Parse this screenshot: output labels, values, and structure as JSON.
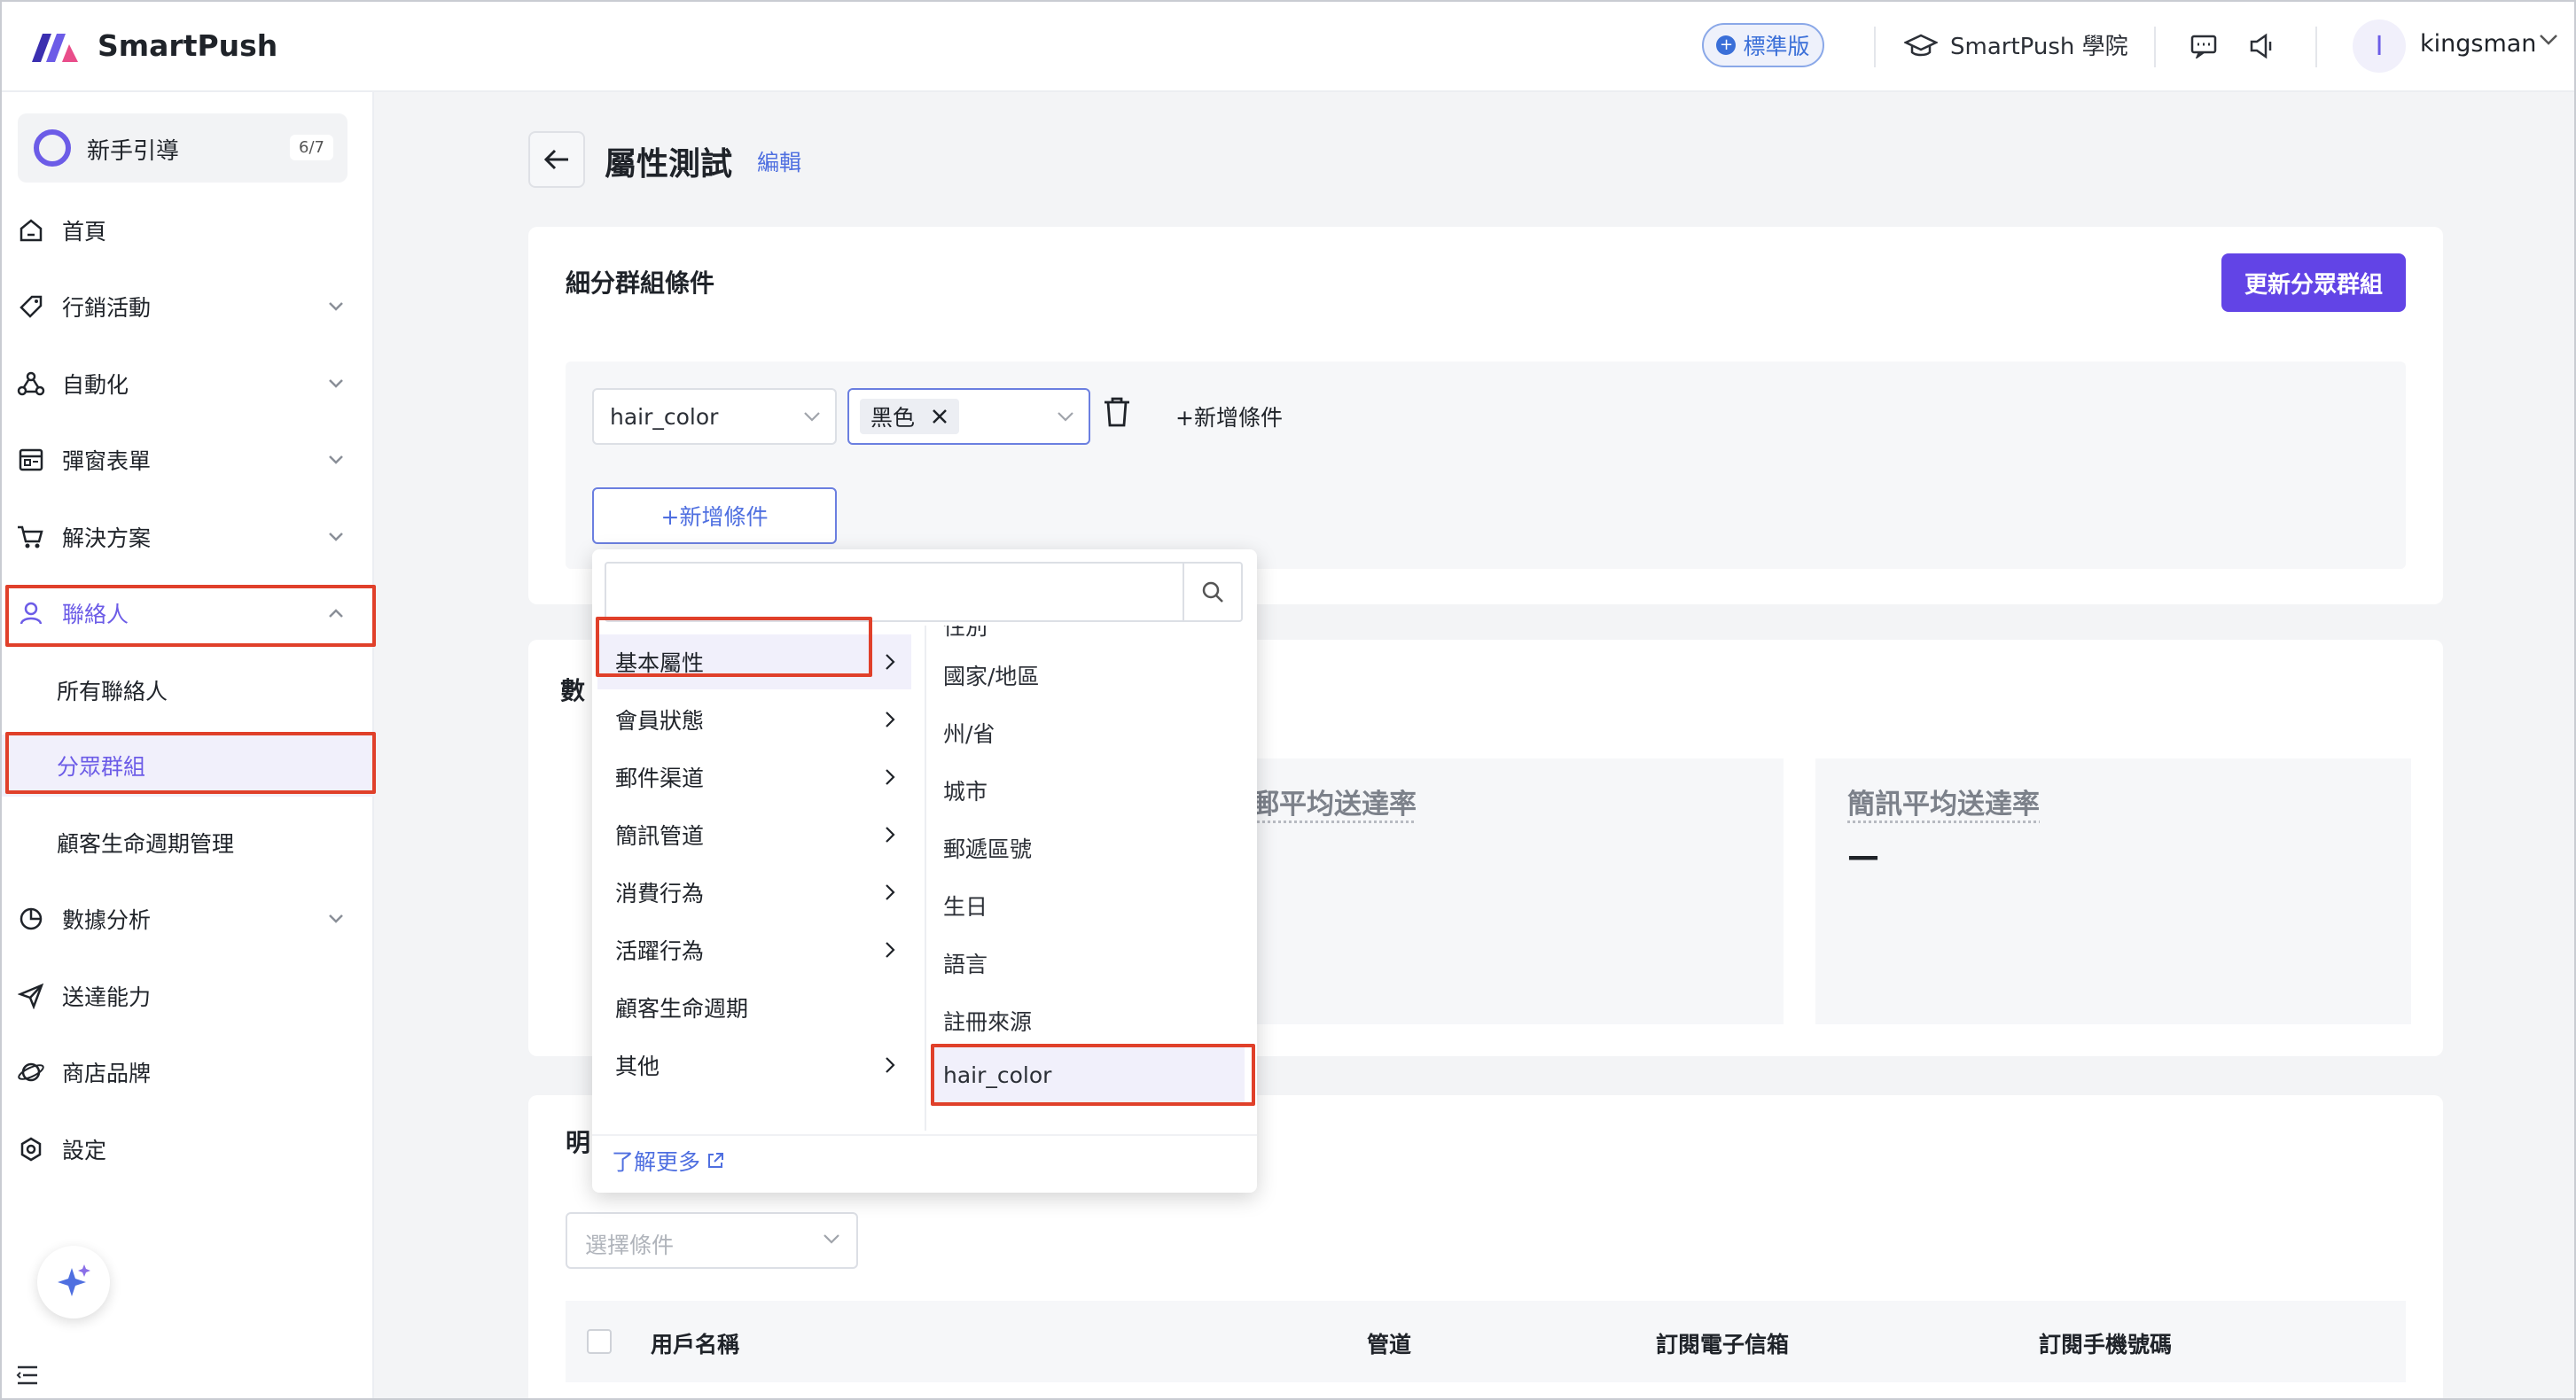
{
  "app": {
    "brand": "SmartPush",
    "plan_badge": "標準版",
    "academy": "SmartPush 學院",
    "avatar_initial": "I",
    "username": "kingsman",
    "accent": "#6244e6",
    "link_color": "#4f6fe0",
    "highlight": "#e0402a"
  },
  "sidebar": {
    "guide_label": "新手引導",
    "guide_count": "6/7",
    "items": [
      {
        "label": "首頁",
        "icon": "home-icon"
      },
      {
        "label": "行銷活動",
        "icon": "tag-icon"
      },
      {
        "label": "自動化",
        "icon": "automation-icon"
      },
      {
        "label": "彈窗表單",
        "icon": "form-icon"
      },
      {
        "label": "解決方案",
        "icon": "cart-icon"
      },
      {
        "label": "聯絡人",
        "icon": "user-icon"
      },
      {
        "label": "數據分析",
        "icon": "chart-icon"
      },
      {
        "label": "送達能力",
        "icon": "send-icon"
      },
      {
        "label": "商店品牌",
        "icon": "brand-icon"
      },
      {
        "label": "設定",
        "icon": "settings-icon"
      }
    ],
    "sub_items": [
      "所有聯絡人",
      "分眾群組",
      "顧客生命週期管理"
    ]
  },
  "page": {
    "title": "屬性測試",
    "edit_link": "編輯"
  },
  "conditions": {
    "title": "細分群組條件",
    "update_button": "更新分眾群組",
    "field_value": "hair_color",
    "tag_value": "黑色",
    "add_inline": "+新增條件",
    "add_button": "+新增條件"
  },
  "stats": {
    "title_partial": "數",
    "email_label_partial": "郵平均送達率",
    "sms_label": "簡訊平均送達率",
    "sms_value": "—"
  },
  "details": {
    "title_partial": "明",
    "filter_placeholder": "選擇條件",
    "columns": [
      "用戶名稱",
      "管道",
      "訂閱電子信箱",
      "訂閱手機號碼"
    ]
  },
  "dropdown": {
    "categories": [
      "基本屬性",
      "會員狀態",
      "郵件渠道",
      "簡訊管道",
      "消費行為",
      "活躍行為",
      "顧客生命週期",
      "其他"
    ],
    "attributes_partial_top": "性別",
    "attributes": [
      "國家/地區",
      "州/省",
      "城市",
      "郵遞區號",
      "生日",
      "語言",
      "註冊來源",
      "hair_color"
    ],
    "learn_more": "了解更多"
  }
}
